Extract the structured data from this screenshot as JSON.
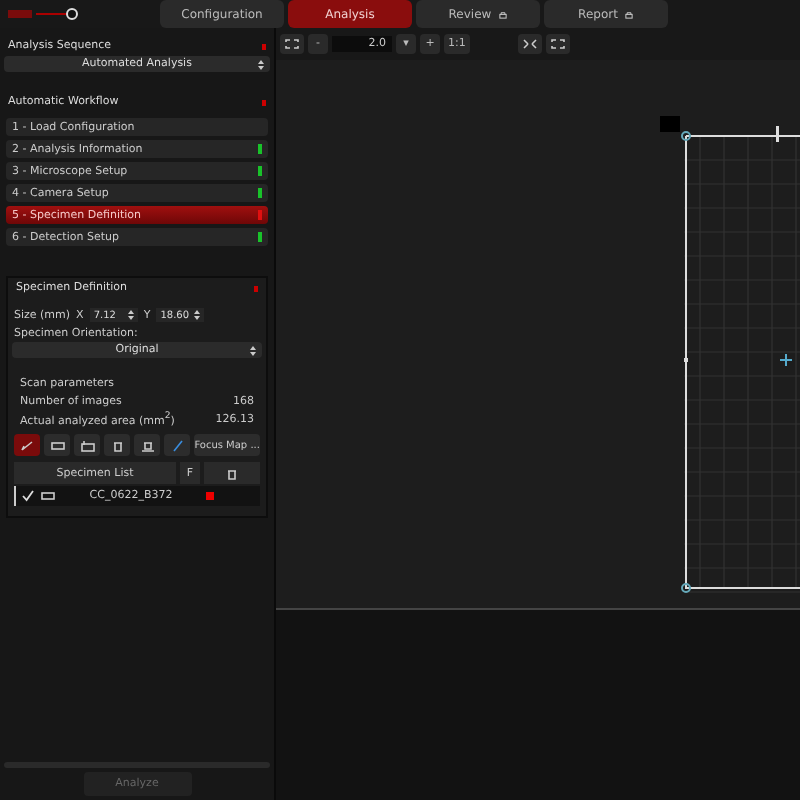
{
  "tabs": [
    {
      "label": "Configuration",
      "selected": false,
      "locked": false
    },
    {
      "label": "Analysis",
      "selected": true,
      "locked": false
    },
    {
      "label": "Review",
      "selected": false,
      "locked": true
    },
    {
      "label": "Report",
      "selected": false,
      "locked": true
    }
  ],
  "toolbar": {
    "zoom_out": "-",
    "zoom_value": "2.0",
    "zoom_menu": "▾",
    "zoom_in": "+",
    "actual_size": "1:1"
  },
  "analysis_sequence": {
    "title": "Analysis Sequence",
    "value": "Automated Analysis"
  },
  "workflow": {
    "title": "Automatic Workflow",
    "steps": [
      {
        "label": "1 - Load Configuration",
        "selected": false
      },
      {
        "label": "2 - Analysis Information",
        "color": "#19c22a",
        "selected": false
      },
      {
        "label": "3 - Microscope Setup",
        "color": "#19c22a",
        "selected": false
      },
      {
        "label": "4 - Camera Setup",
        "color": "#19c22a",
        "selected": false
      },
      {
        "label": "5 - Specimen Definition",
        "color": "#e01010",
        "selected": true
      },
      {
        "label": "6 - Detection Setup",
        "color": "#19c22a",
        "selected": false
      }
    ]
  },
  "specimen": {
    "title": "Specimen Definition",
    "size_label": "Size (mm)",
    "x_label": "X",
    "x_value": "7.12",
    "y_label": "Y",
    "y_value": "18.60",
    "orientation_label": "Specimen Orientation:",
    "orientation": "Original",
    "scan_title": "Scan parameters",
    "params": [
      {
        "label": "Number of images",
        "value": "168"
      },
      {
        "label": "Actual analyzed area (mm$^{2}$)",
        "value": "126.13"
      }
    ],
    "focus_map": "Focus Map ...",
    "list_button": "Specimen List",
    "f_label": "F",
    "rows": [
      {
        "name": "CC_0622_B372",
        "checked": true
      }
    ]
  },
  "analyze_button": "Analyze"
}
